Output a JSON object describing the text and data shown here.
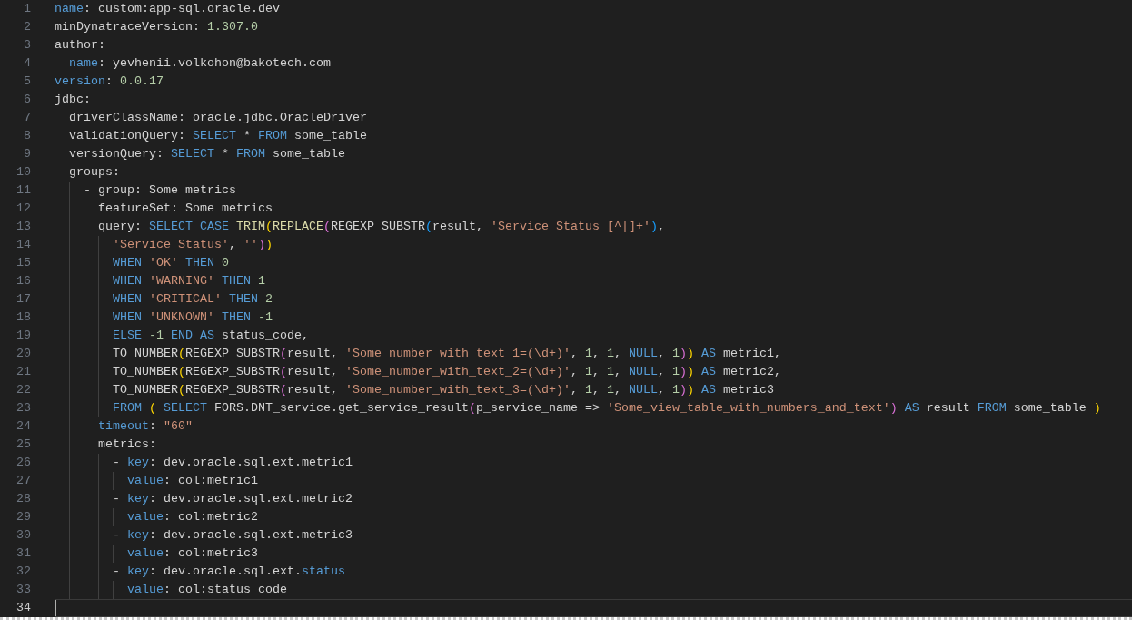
{
  "editor": {
    "lines": [
      {
        "number": "1",
        "current": false,
        "tokens": [
          {
            "text": "name",
            "kind": "key"
          },
          {
            "text": ": custom:app-sql.oracle.dev",
            "kind": "plain"
          }
        ]
      },
      {
        "number": "2",
        "current": false,
        "tokens": [
          {
            "text": "minDynatraceVersion: ",
            "kind": "plain"
          },
          {
            "text": "1.307.0",
            "kind": "num"
          }
        ]
      },
      {
        "number": "3",
        "current": false,
        "tokens": [
          {
            "text": "author:",
            "kind": "plain"
          }
        ]
      },
      {
        "number": "4",
        "current": false,
        "tokens": [
          {
            "text": "  name",
            "kind": "key"
          },
          {
            "text": ": yevhenii.volkohon@bakotech.com",
            "kind": "plain"
          }
        ]
      },
      {
        "number": "5",
        "current": false,
        "tokens": [
          {
            "text": "version",
            "kind": "key"
          },
          {
            "text": ": ",
            "kind": "plain"
          },
          {
            "text": "0.0.17",
            "kind": "num"
          }
        ]
      },
      {
        "number": "6",
        "current": false,
        "tokens": [
          {
            "text": "jdbc:",
            "kind": "plain"
          }
        ]
      },
      {
        "number": "7",
        "current": false,
        "tokens": [
          {
            "text": "  driverClassName: oracle.jdbc.OracleDriver",
            "kind": "plain"
          }
        ]
      },
      {
        "number": "8",
        "current": false,
        "tokens": [
          {
            "text": "  validationQuery: ",
            "kind": "plain"
          },
          {
            "text": "SELECT",
            "kind": "kw"
          },
          {
            "text": " * ",
            "kind": "plain"
          },
          {
            "text": "FROM",
            "kind": "kw"
          },
          {
            "text": " some_table",
            "kind": "plain"
          }
        ]
      },
      {
        "number": "9",
        "current": false,
        "tokens": [
          {
            "text": "  versionQuery: ",
            "kind": "plain"
          },
          {
            "text": "SELECT",
            "kind": "kw"
          },
          {
            "text": " * ",
            "kind": "plain"
          },
          {
            "text": "FROM",
            "kind": "kw"
          },
          {
            "text": " some_table",
            "kind": "plain"
          }
        ]
      },
      {
        "number": "10",
        "current": false,
        "tokens": [
          {
            "text": "  groups:",
            "kind": "plain"
          }
        ]
      },
      {
        "number": "11",
        "current": false,
        "tokens": [
          {
            "text": "    - group: Some metrics",
            "kind": "plain"
          }
        ]
      },
      {
        "number": "12",
        "current": false,
        "tokens": [
          {
            "text": "      featureSet: Some metrics",
            "kind": "plain"
          }
        ]
      },
      {
        "number": "13",
        "current": false,
        "tokens": [
          {
            "text": "      query: ",
            "kind": "plain"
          },
          {
            "text": "SELECT CASE ",
            "kind": "kw"
          },
          {
            "text": "TRIM",
            "kind": "fn"
          },
          {
            "text": "(",
            "kind": "b1"
          },
          {
            "text": "REPLACE",
            "kind": "fn"
          },
          {
            "text": "(",
            "kind": "b2"
          },
          {
            "text": "REGEXP_SUBSTR",
            "kind": "plain"
          },
          {
            "text": "(",
            "kind": "b3"
          },
          {
            "text": "result, ",
            "kind": "plain"
          },
          {
            "text": "'Service Status [^|]+'",
            "kind": "str"
          },
          {
            "text": ")",
            "kind": "b3"
          },
          {
            "text": ",",
            "kind": "plain"
          }
        ]
      },
      {
        "number": "14",
        "current": false,
        "tokens": [
          {
            "text": "        'Service Status'",
            "kind": "str"
          },
          {
            "text": ", ",
            "kind": "plain"
          },
          {
            "text": "''",
            "kind": "str"
          },
          {
            "text": ")",
            "kind": "b2"
          },
          {
            "text": ")",
            "kind": "b1"
          }
        ]
      },
      {
        "number": "15",
        "current": false,
        "tokens": [
          {
            "text": "        WHEN ",
            "kind": "kw"
          },
          {
            "text": "'OK' ",
            "kind": "str"
          },
          {
            "text": "THEN ",
            "kind": "kw"
          },
          {
            "text": "0",
            "kind": "num"
          }
        ]
      },
      {
        "number": "16",
        "current": false,
        "tokens": [
          {
            "text": "        WHEN ",
            "kind": "kw"
          },
          {
            "text": "'WARNING' ",
            "kind": "str"
          },
          {
            "text": "THEN ",
            "kind": "kw"
          },
          {
            "text": "1",
            "kind": "num"
          }
        ]
      },
      {
        "number": "17",
        "current": false,
        "tokens": [
          {
            "text": "        WHEN ",
            "kind": "kw"
          },
          {
            "text": "'CRITICAL' ",
            "kind": "str"
          },
          {
            "text": "THEN ",
            "kind": "kw"
          },
          {
            "text": "2",
            "kind": "num"
          }
        ]
      },
      {
        "number": "18",
        "current": false,
        "tokens": [
          {
            "text": "        WHEN ",
            "kind": "kw"
          },
          {
            "text": "'UNKNOWN' ",
            "kind": "str"
          },
          {
            "text": "THEN ",
            "kind": "kw"
          },
          {
            "text": "-1",
            "kind": "num"
          }
        ]
      },
      {
        "number": "19",
        "current": false,
        "tokens": [
          {
            "text": "        ELSE ",
            "kind": "kw"
          },
          {
            "text": "-1 ",
            "kind": "num"
          },
          {
            "text": "END AS",
            "kind": "kw"
          },
          {
            "text": " status_code,",
            "kind": "plain"
          }
        ]
      },
      {
        "number": "20",
        "current": false,
        "tokens": [
          {
            "text": "        TO_NUMBER",
            "kind": "plain"
          },
          {
            "text": "(",
            "kind": "b1"
          },
          {
            "text": "REGEXP_SUBSTR",
            "kind": "plain"
          },
          {
            "text": "(",
            "kind": "b2"
          },
          {
            "text": "result, ",
            "kind": "plain"
          },
          {
            "text": "'Some_number_with_text_1=(\\d+)'",
            "kind": "str"
          },
          {
            "text": ", ",
            "kind": "plain"
          },
          {
            "text": "1",
            "kind": "num"
          },
          {
            "text": ", ",
            "kind": "plain"
          },
          {
            "text": "1",
            "kind": "num"
          },
          {
            "text": ", ",
            "kind": "plain"
          },
          {
            "text": "NULL",
            "kind": "kw"
          },
          {
            "text": ", ",
            "kind": "plain"
          },
          {
            "text": "1",
            "kind": "num"
          },
          {
            "text": ")",
            "kind": "b2"
          },
          {
            "text": ") ",
            "kind": "b1"
          },
          {
            "text": "AS",
            "kind": "kw"
          },
          {
            "text": " metric1,",
            "kind": "plain"
          }
        ]
      },
      {
        "number": "21",
        "current": false,
        "tokens": [
          {
            "text": "        TO_NUMBER",
            "kind": "plain"
          },
          {
            "text": "(",
            "kind": "b1"
          },
          {
            "text": "REGEXP_SUBSTR",
            "kind": "plain"
          },
          {
            "text": "(",
            "kind": "b2"
          },
          {
            "text": "result, ",
            "kind": "plain"
          },
          {
            "text": "'Some_number_with_text_2=(\\d+)'",
            "kind": "str"
          },
          {
            "text": ", ",
            "kind": "plain"
          },
          {
            "text": "1",
            "kind": "num"
          },
          {
            "text": ", ",
            "kind": "plain"
          },
          {
            "text": "1",
            "kind": "num"
          },
          {
            "text": ", ",
            "kind": "plain"
          },
          {
            "text": "NULL",
            "kind": "kw"
          },
          {
            "text": ", ",
            "kind": "plain"
          },
          {
            "text": "1",
            "kind": "num"
          },
          {
            "text": ")",
            "kind": "b2"
          },
          {
            "text": ") ",
            "kind": "b1"
          },
          {
            "text": "AS",
            "kind": "kw"
          },
          {
            "text": " metric2,",
            "kind": "plain"
          }
        ]
      },
      {
        "number": "22",
        "current": false,
        "tokens": [
          {
            "text": "        TO_NUMBER",
            "kind": "plain"
          },
          {
            "text": "(",
            "kind": "b1"
          },
          {
            "text": "REGEXP_SUBSTR",
            "kind": "plain"
          },
          {
            "text": "(",
            "kind": "b2"
          },
          {
            "text": "result, ",
            "kind": "plain"
          },
          {
            "text": "'Some_number_with_text_3=(\\d+)'",
            "kind": "str"
          },
          {
            "text": ", ",
            "kind": "plain"
          },
          {
            "text": "1",
            "kind": "num"
          },
          {
            "text": ", ",
            "kind": "plain"
          },
          {
            "text": "1",
            "kind": "num"
          },
          {
            "text": ", ",
            "kind": "plain"
          },
          {
            "text": "NULL",
            "kind": "kw"
          },
          {
            "text": ", ",
            "kind": "plain"
          },
          {
            "text": "1",
            "kind": "num"
          },
          {
            "text": ")",
            "kind": "b2"
          },
          {
            "text": ") ",
            "kind": "b1"
          },
          {
            "text": "AS",
            "kind": "kw"
          },
          {
            "text": " metric3",
            "kind": "plain"
          }
        ]
      },
      {
        "number": "23",
        "current": false,
        "tokens": [
          {
            "text": "        FROM ",
            "kind": "kw"
          },
          {
            "text": "( ",
            "kind": "b1"
          },
          {
            "text": "SELECT",
            "kind": "kw"
          },
          {
            "text": " FORS.DNT_service.get_service_result",
            "kind": "plain"
          },
          {
            "text": "(",
            "kind": "b2"
          },
          {
            "text": "p_service_name => ",
            "kind": "plain"
          },
          {
            "text": "'Some_view_table_with_numbers_and_text'",
            "kind": "str"
          },
          {
            "text": ") ",
            "kind": "b2"
          },
          {
            "text": "AS",
            "kind": "kw"
          },
          {
            "text": " result ",
            "kind": "plain"
          },
          {
            "text": "FROM",
            "kind": "kw"
          },
          {
            "text": " some_table ",
            "kind": "plain"
          },
          {
            "text": ")",
            "kind": "b1"
          }
        ]
      },
      {
        "number": "24",
        "current": false,
        "tokens": [
          {
            "text": "      timeout",
            "kind": "key"
          },
          {
            "text": ": ",
            "kind": "plain"
          },
          {
            "text": "\"60\"",
            "kind": "str"
          }
        ]
      },
      {
        "number": "25",
        "current": false,
        "tokens": [
          {
            "text": "      metrics:",
            "kind": "plain"
          }
        ]
      },
      {
        "number": "26",
        "current": false,
        "tokens": [
          {
            "text": "        - ",
            "kind": "plain"
          },
          {
            "text": "key",
            "kind": "key"
          },
          {
            "text": ": dev.oracle.sql.ext.metric1",
            "kind": "plain"
          }
        ]
      },
      {
        "number": "27",
        "current": false,
        "tokens": [
          {
            "text": "          value",
            "kind": "key"
          },
          {
            "text": ": col:metric1",
            "kind": "plain"
          }
        ]
      },
      {
        "number": "28",
        "current": false,
        "tokens": [
          {
            "text": "        - ",
            "kind": "plain"
          },
          {
            "text": "key",
            "kind": "key"
          },
          {
            "text": ": dev.oracle.sql.ext.metric2",
            "kind": "plain"
          }
        ]
      },
      {
        "number": "29",
        "current": false,
        "tokens": [
          {
            "text": "          value",
            "kind": "key"
          },
          {
            "text": ": col:metric2",
            "kind": "plain"
          }
        ]
      },
      {
        "number": "30",
        "current": false,
        "tokens": [
          {
            "text": "        - ",
            "kind": "plain"
          },
          {
            "text": "key",
            "kind": "key"
          },
          {
            "text": ": dev.oracle.sql.ext.metric3",
            "kind": "plain"
          }
        ]
      },
      {
        "number": "31",
        "current": false,
        "tokens": [
          {
            "text": "          value",
            "kind": "key"
          },
          {
            "text": ": col:metric3",
            "kind": "plain"
          }
        ]
      },
      {
        "number": "32",
        "current": false,
        "tokens": [
          {
            "text": "        - ",
            "kind": "plain"
          },
          {
            "text": "key",
            "kind": "key"
          },
          {
            "text": ": dev.oracle.sql.ext.",
            "kind": "plain"
          },
          {
            "text": "status",
            "kind": "key"
          }
        ]
      },
      {
        "number": "33",
        "current": false,
        "tokens": [
          {
            "text": "          value",
            "kind": "key"
          },
          {
            "text": ": col:status_code",
            "kind": "plain"
          }
        ]
      },
      {
        "number": "34",
        "current": true
      }
    ]
  }
}
